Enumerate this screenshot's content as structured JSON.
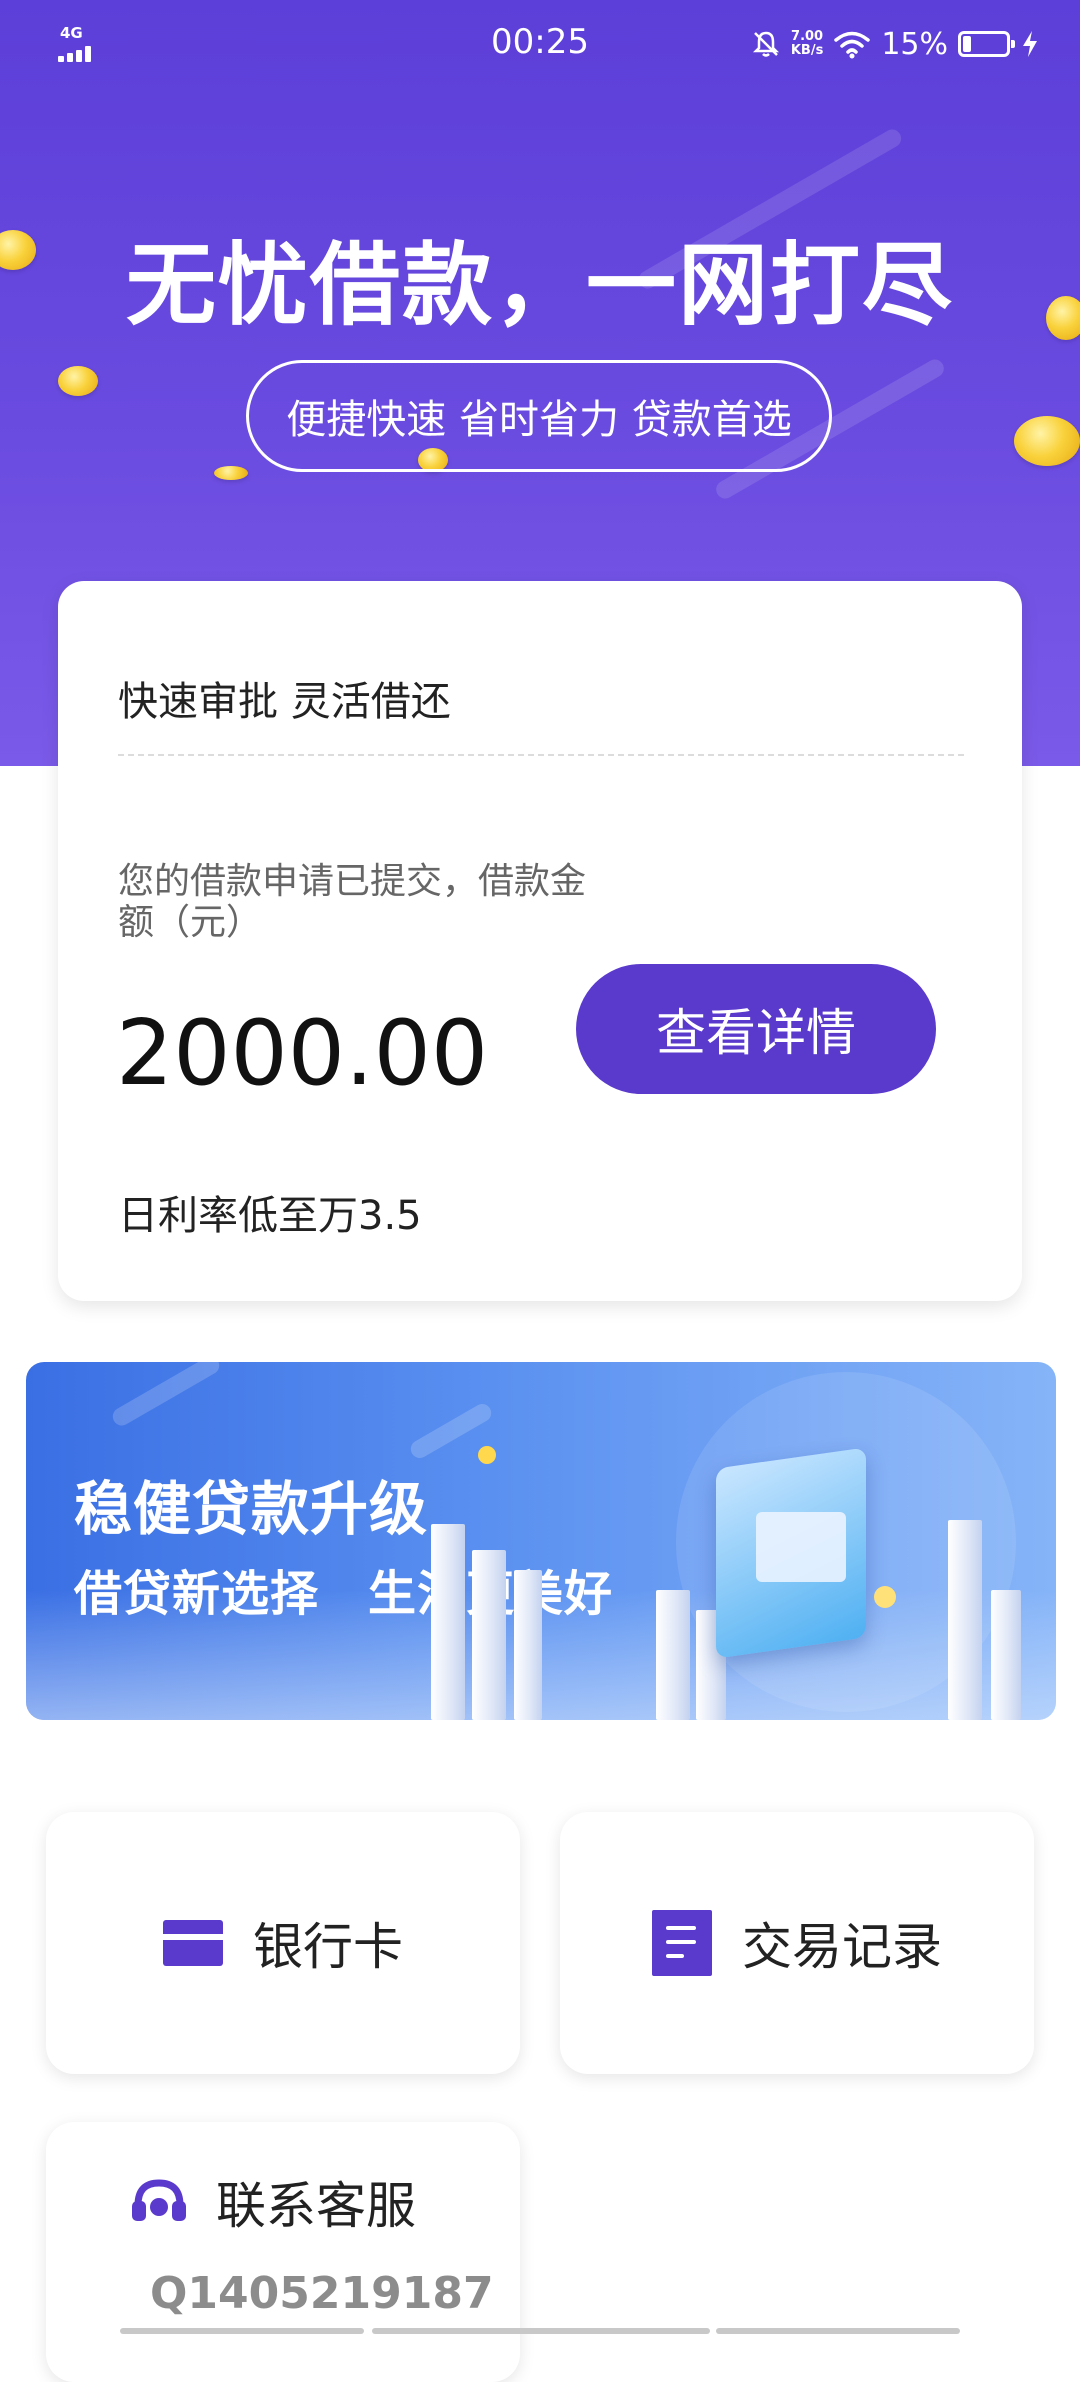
{
  "status_bar": {
    "network": "4G",
    "time": "00:25",
    "speed_value": "7.00",
    "speed_unit": "KB/s",
    "battery": "15%"
  },
  "hero": {
    "title": "无忧借款，一网打尽",
    "subtitle": "便捷快速 省时省力 贷款首选"
  },
  "loan_card": {
    "header": "快速审批 灵活借还",
    "status_text": "您的借款申请已提交，借款金额（元）",
    "amount": "2000.00",
    "button_label": "查看详情",
    "rate_text": "日利率低至万3.5"
  },
  "banner": {
    "title": "稳健贷款升级",
    "subtitle": "借贷新选择　生活更美好"
  },
  "tiles": {
    "bank_card_label": "银行卡",
    "records_label": "交易记录",
    "service_label": "联系客服",
    "service_id": "Q1405219187"
  },
  "icons": {
    "bank_card": "credit-card-icon",
    "records": "document-icon",
    "service": "headset-icon"
  },
  "colors": {
    "brand": "#5a3acc",
    "hero_top": "#5c3fd8",
    "banner_blue": "#3a6fe4"
  }
}
